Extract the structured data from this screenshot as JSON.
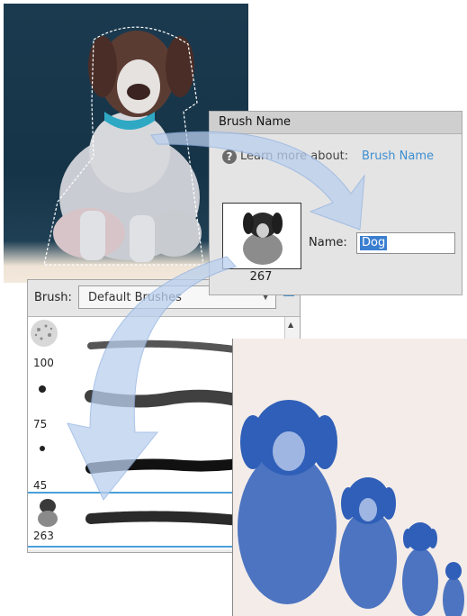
{
  "dialog": {
    "title": "Brush Name",
    "learn_more_text": "Learn more about:",
    "learn_more_link": "Brush Name",
    "help_icon": "question-icon",
    "thumbnail_count": "267",
    "name_label": "Name:",
    "name_value": "Dog"
  },
  "brush_panel": {
    "label": "Brush:",
    "preset": "Default Brushes",
    "menu_icon": "panel-menu-icon",
    "brushes": [
      {
        "size": "100",
        "type": "spatter"
      },
      {
        "size": "75",
        "type": "soft-round"
      },
      {
        "size": "45",
        "type": "hard-round"
      },
      {
        "size": "263",
        "type": "dog-custom",
        "selected": true
      }
    ]
  },
  "colors": {
    "accent": "#3d8fd1",
    "selection": "#3b7fd1",
    "arrow_fill": "#b9cfee",
    "result_ink": "#2a5bb5",
    "result_bg": "#f3ece9"
  }
}
